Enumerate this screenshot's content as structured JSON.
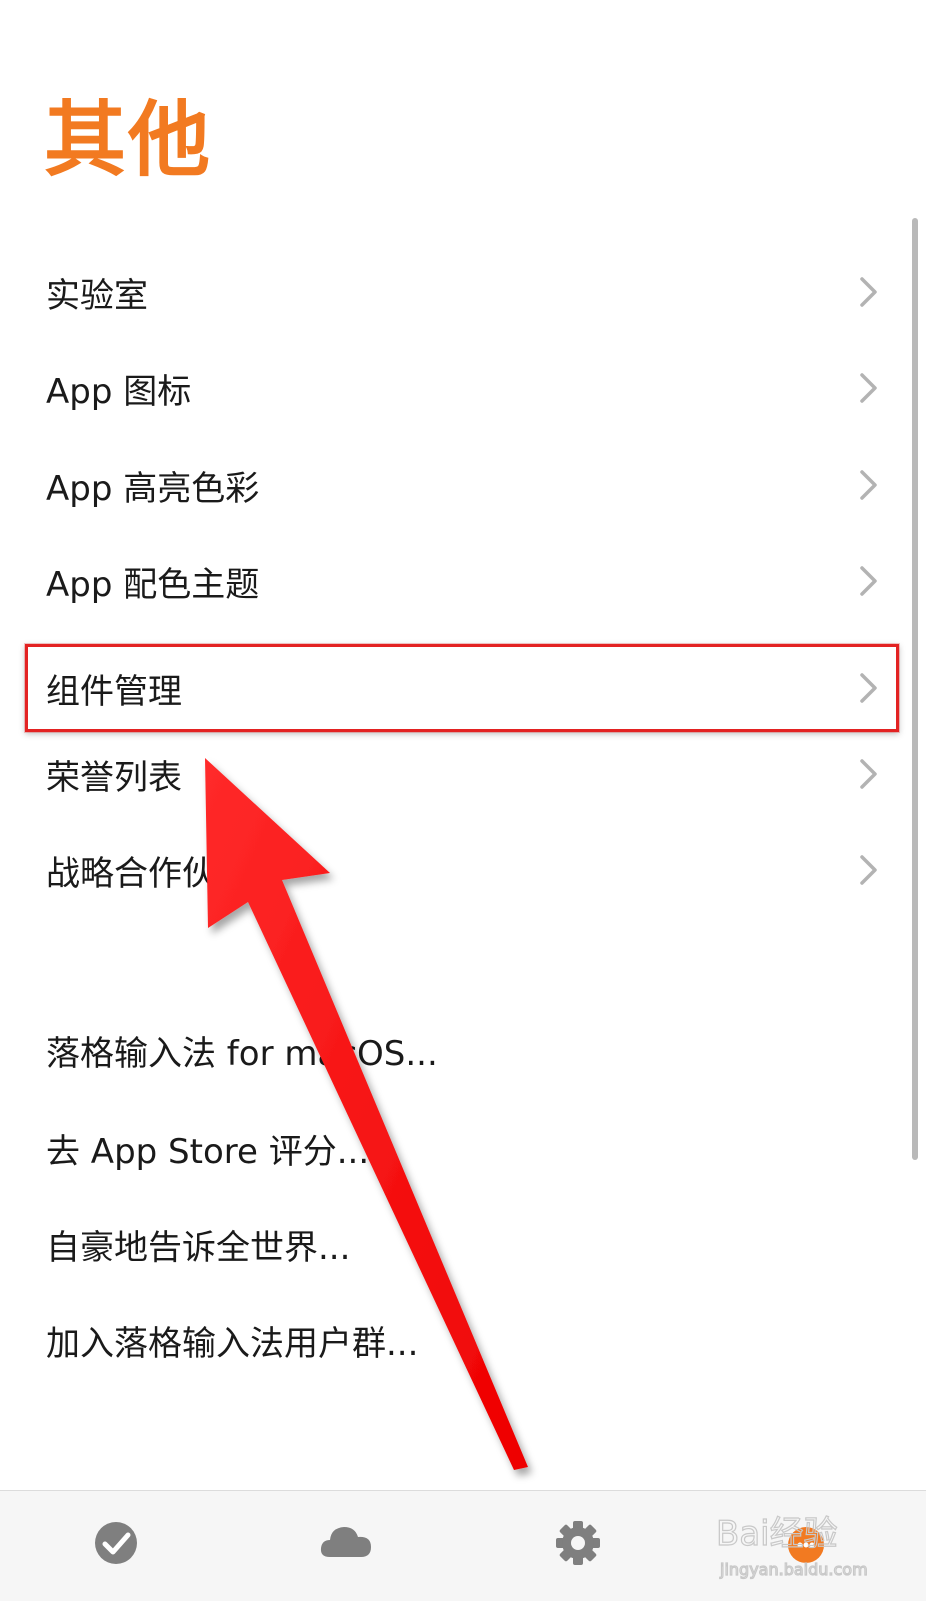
{
  "page": {
    "title": "其他"
  },
  "menu": {
    "items": [
      {
        "label": "实验室",
        "has_chevron": true
      },
      {
        "label": "App 图标",
        "has_chevron": true
      },
      {
        "label": "App 高亮色彩",
        "has_chevron": true
      },
      {
        "label": "App 配色主题",
        "has_chevron": true
      },
      {
        "label": "组件管理",
        "has_chevron": true,
        "highlighted": true
      },
      {
        "label": "荣誉列表",
        "has_chevron": true
      },
      {
        "label": "战略合作伙伴",
        "has_chevron": true
      }
    ],
    "actions": [
      {
        "label": "落格输入法 for macOS..."
      },
      {
        "label": "去 App Store 评分..."
      },
      {
        "label": "自豪地告诉全世界..."
      },
      {
        "label": "加入落格输入法用户群..."
      }
    ]
  },
  "tabbar": {
    "tabs": [
      {
        "icon": "checkmark-circle-icon"
      },
      {
        "icon": "cloud-icon"
      },
      {
        "icon": "gear-icon"
      },
      {
        "icon": "more-icon",
        "active": true
      }
    ]
  },
  "watermark": {
    "text": "Bai经验",
    "subtext": "jingyan.baidu.com"
  },
  "colors": {
    "accent": "#f27a21",
    "highlight_border": "#e32222",
    "arrow": "#ff0000",
    "tab_icon": "#7f7f7f"
  }
}
